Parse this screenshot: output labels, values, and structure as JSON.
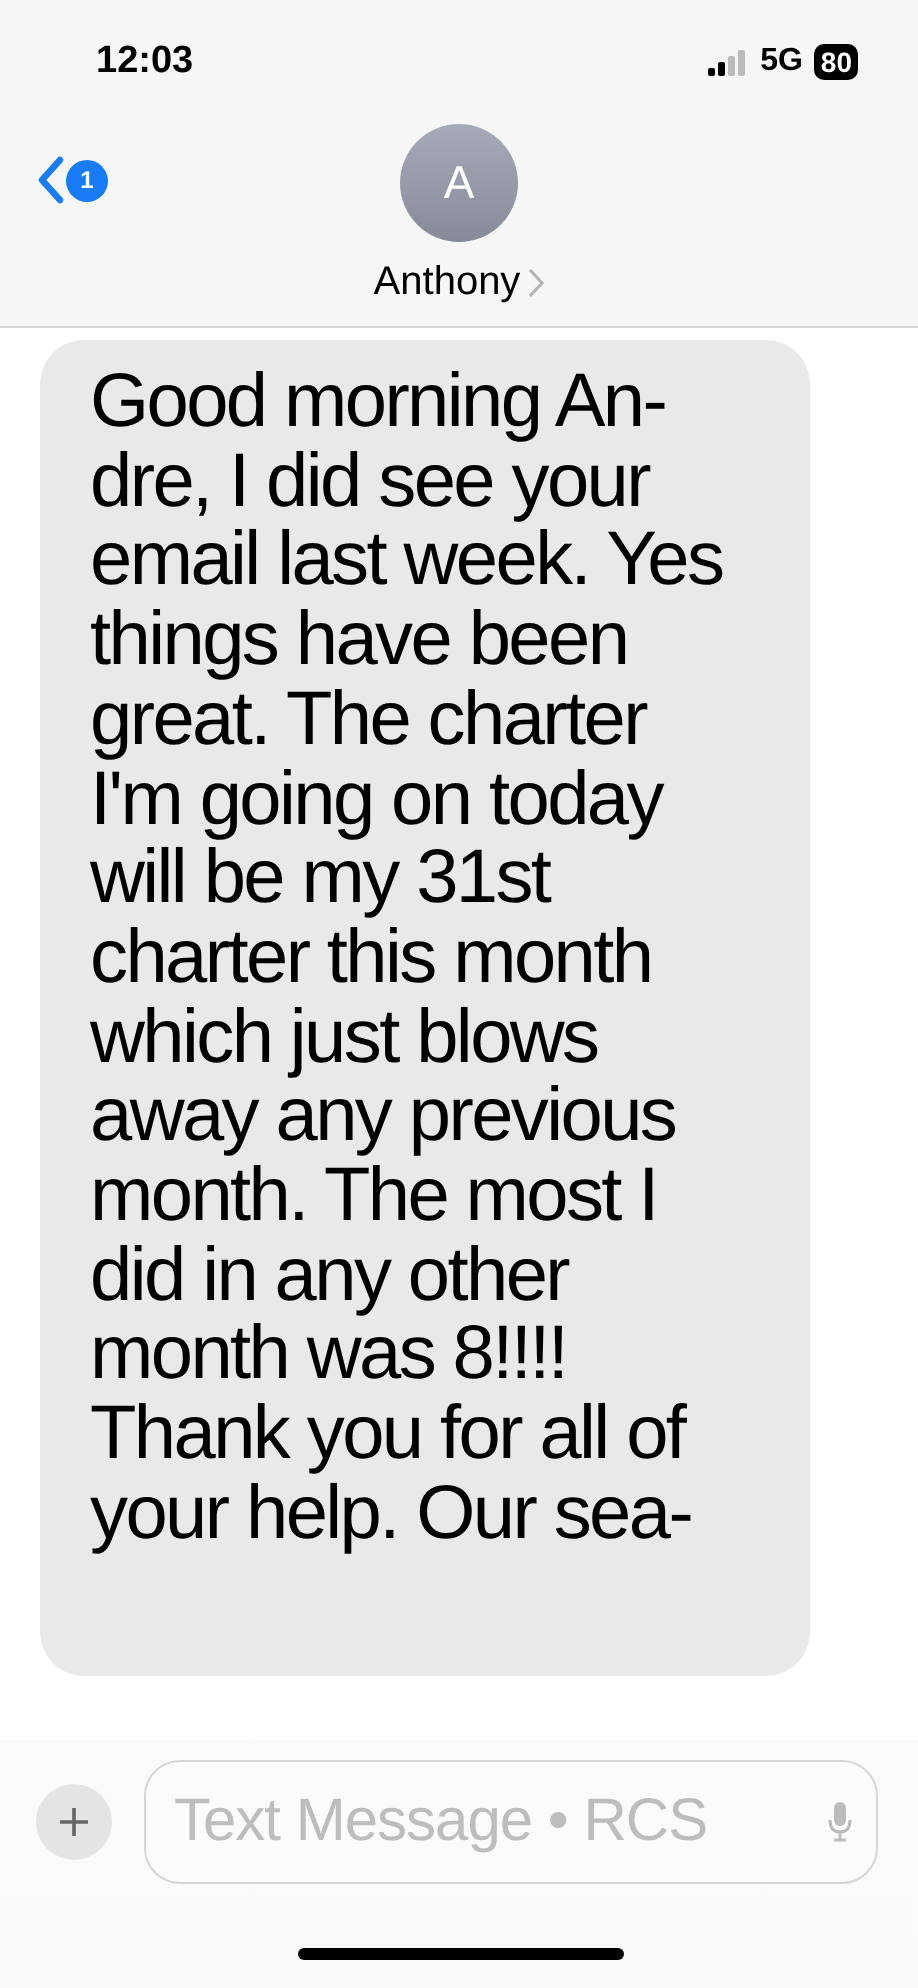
{
  "status_bar": {
    "time": "12:03",
    "network": "5G",
    "battery": "80"
  },
  "header": {
    "back_badge": "1",
    "avatar_initial": "A",
    "contact_name": "Anthony"
  },
  "messages": [
    {
      "kind": "incoming",
      "text": "Good morning An-\ndre, I did see your\nemail last week. Yes\nthings have been\ngreat. The charter\nI'm going on today\nwill be my 31st\ncharter this month\nwhich just blows\naway any previous\nmonth. The most I\ndid in any other\nmonth was 8!!!!\nThank you for all of\nyour help. Our sea-"
    }
  ],
  "composer": {
    "placeholder": "Text Message • RCS"
  }
}
